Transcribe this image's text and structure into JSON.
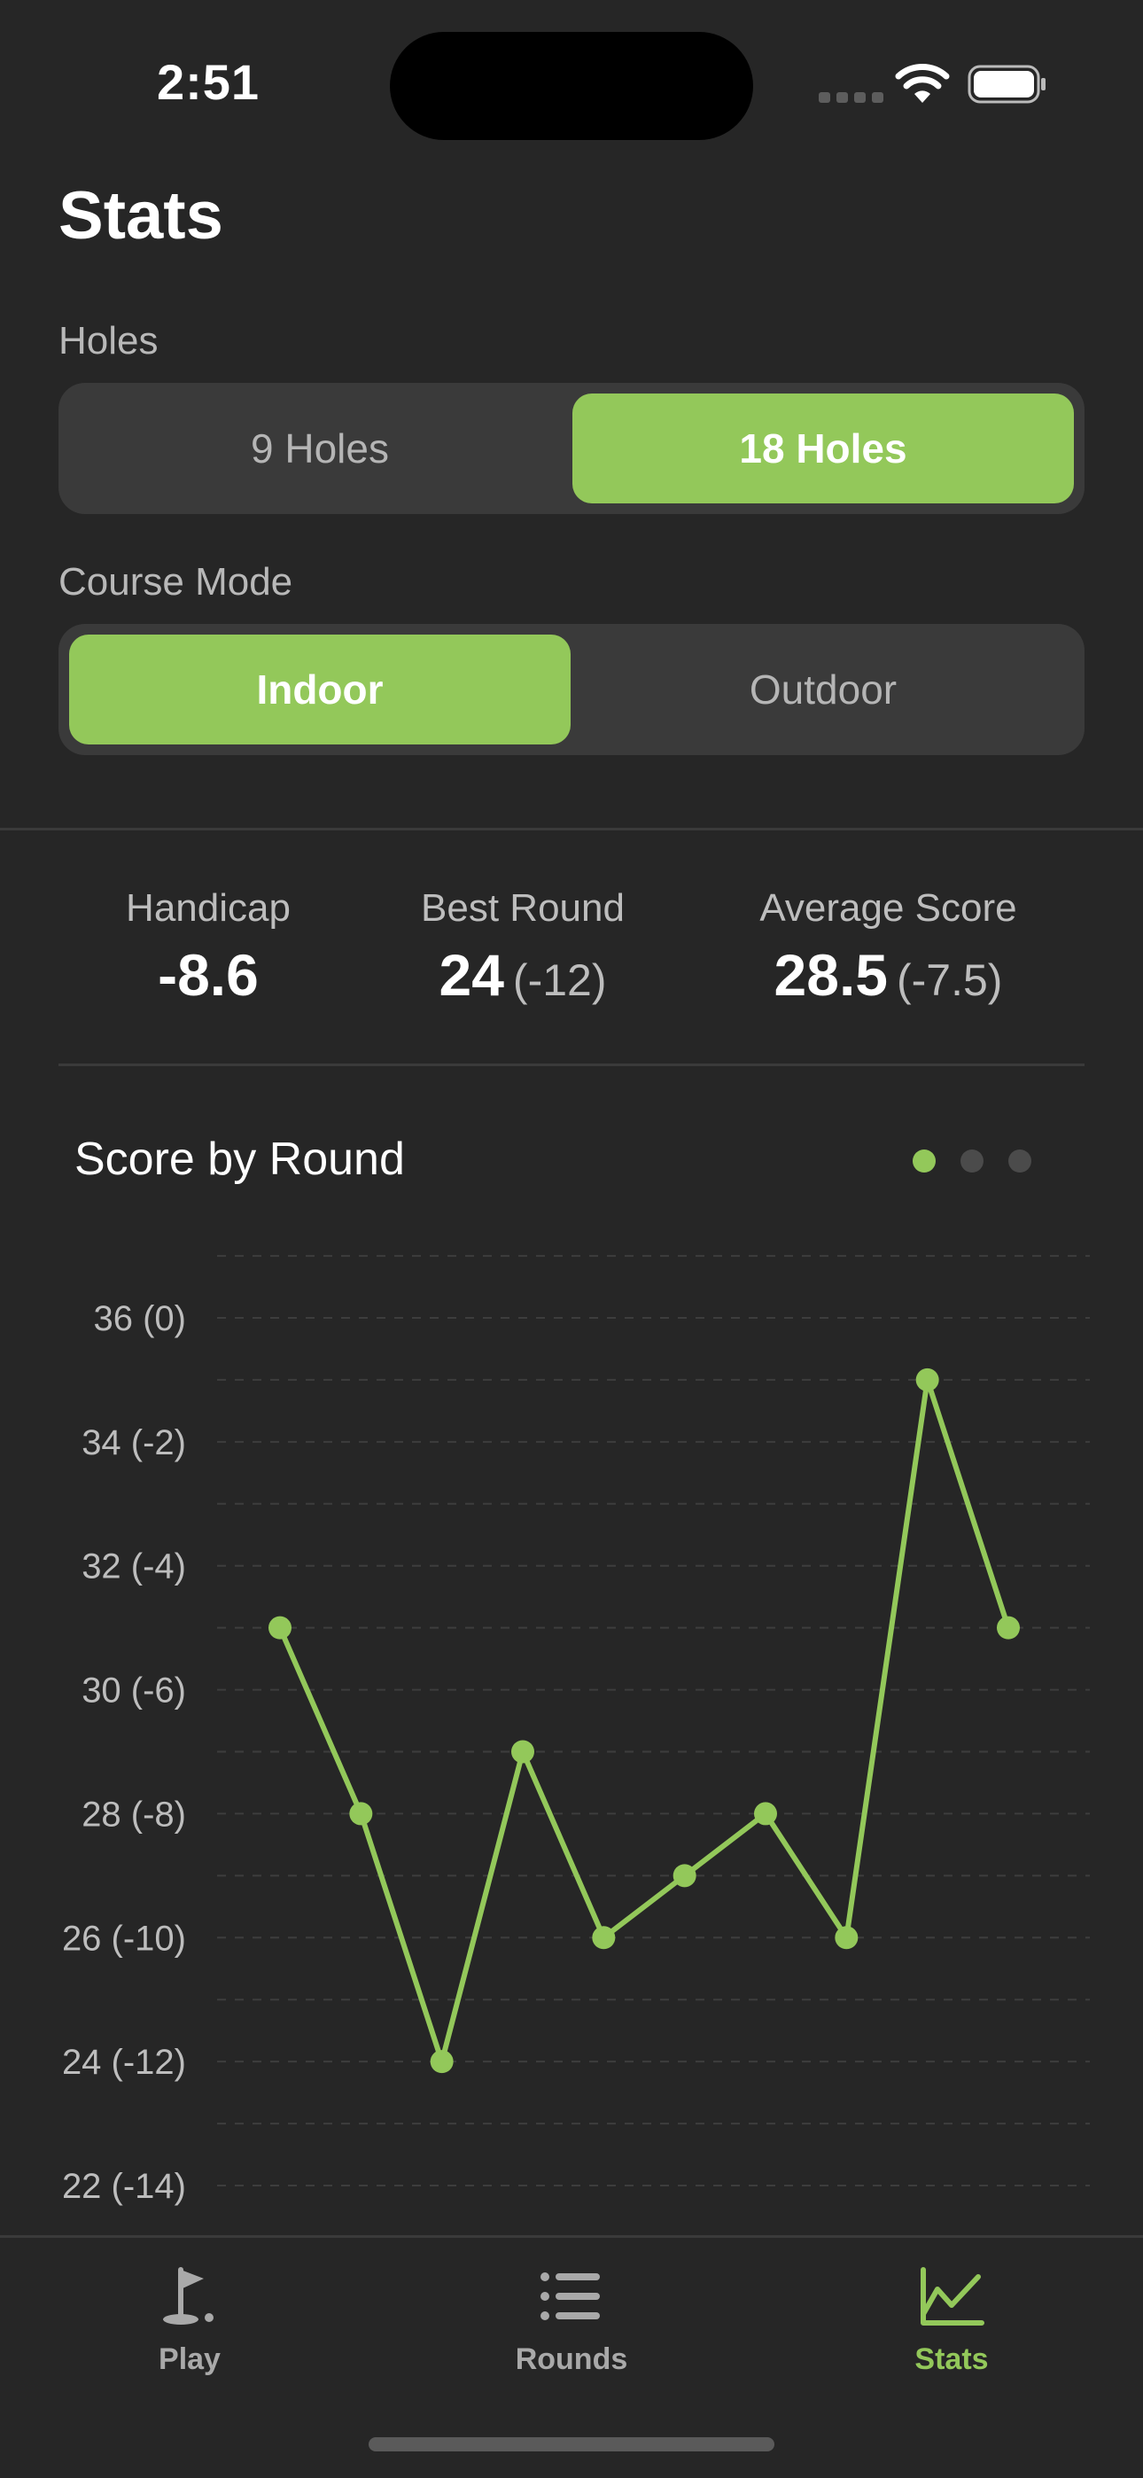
{
  "status": {
    "time": "2:51"
  },
  "title": "Stats",
  "holes": {
    "label": "Holes",
    "options": [
      "9 Holes",
      "18 Holes"
    ],
    "selected": "18 Holes"
  },
  "course_mode": {
    "label": "Course Mode",
    "options": [
      "Indoor",
      "Outdoor"
    ],
    "selected": "Indoor"
  },
  "metrics": {
    "handicap": {
      "label": "Handicap",
      "value": "-8.6"
    },
    "best_round": {
      "label": "Best Round",
      "value": "24",
      "relative": "(-12)"
    },
    "average_score": {
      "label": "Average Score",
      "value": "28.5",
      "relative": "(-7.5)"
    }
  },
  "chart_title": "Score by Round",
  "page_indicator": {
    "pages": 3,
    "current": 1
  },
  "colors": {
    "accent": "#93c85a",
    "background": "#262626",
    "segment_bg": "#3a3a3a"
  },
  "chart_data": {
    "type": "line",
    "title": "Score by Round",
    "xlabel": "",
    "ylabel": "",
    "x": [
      1,
      2,
      3,
      4,
      5,
      6,
      7,
      8,
      9,
      10
    ],
    "series": [
      {
        "values": [
          31,
          28,
          24,
          29,
          26,
          27,
          28,
          26,
          35,
          31
        ]
      }
    ],
    "ylim": [
      22,
      36
    ],
    "ytick_values": [
      22,
      24,
      26,
      28,
      30,
      32,
      34,
      36
    ],
    "ytick_labels": [
      "22 (-14)",
      "24 (-12)",
      "26 (-10)",
      "28 (-8)",
      "30 (-6)",
      "32 (-4)",
      "34 (-2)",
      "36 (0)"
    ],
    "grid": true
  },
  "tabs": [
    {
      "label": "Play",
      "icon": "golf-flag-icon",
      "active": false
    },
    {
      "label": "Rounds",
      "icon": "list-icon",
      "active": false
    },
    {
      "label": "Stats",
      "icon": "chart-line-icon",
      "active": true
    }
  ]
}
